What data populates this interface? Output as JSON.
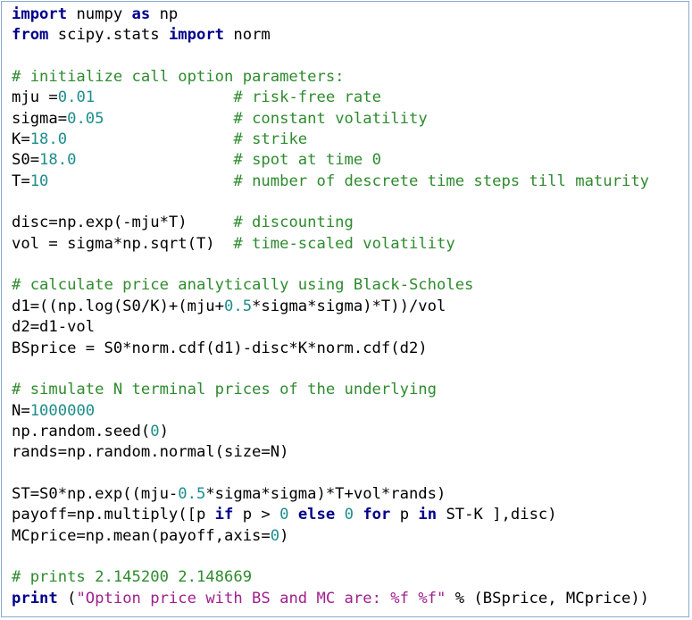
{
  "colors": {
    "keyword": "#00008b",
    "number": "#1e8c8c",
    "comment": "#2e8b2e",
    "string": "#a0208c",
    "text": "#000000",
    "border": "#8aa8d4"
  },
  "code_lines": [
    [
      {
        "t": "import",
        "c": "kw"
      },
      {
        "t": " numpy ",
        "c": ""
      },
      {
        "t": "as",
        "c": "kw"
      },
      {
        "t": " np",
        "c": ""
      }
    ],
    [
      {
        "t": "from",
        "c": "kw"
      },
      {
        "t": " scipy.stats ",
        "c": ""
      },
      {
        "t": "import",
        "c": "kw"
      },
      {
        "t": " norm",
        "c": ""
      }
    ],
    [],
    [
      {
        "t": "# initialize call option parameters:",
        "c": "com"
      }
    ],
    [
      {
        "t": "mju =",
        "c": ""
      },
      {
        "t": "0.01",
        "c": "num"
      },
      {
        "t": "               ",
        "c": ""
      },
      {
        "t": "# risk-free rate",
        "c": "com"
      }
    ],
    [
      {
        "t": "sigma=",
        "c": ""
      },
      {
        "t": "0.05",
        "c": "num"
      },
      {
        "t": "              ",
        "c": ""
      },
      {
        "t": "# constant volatility",
        "c": "com"
      }
    ],
    [
      {
        "t": "K=",
        "c": ""
      },
      {
        "t": "18.0",
        "c": "num"
      },
      {
        "t": "                  ",
        "c": ""
      },
      {
        "t": "# strike",
        "c": "com"
      }
    ],
    [
      {
        "t": "S0=",
        "c": ""
      },
      {
        "t": "18.0",
        "c": "num"
      },
      {
        "t": "                 ",
        "c": ""
      },
      {
        "t": "# spot at time 0",
        "c": "com"
      }
    ],
    [
      {
        "t": "T=",
        "c": ""
      },
      {
        "t": "10",
        "c": "num"
      },
      {
        "t": "                    ",
        "c": ""
      },
      {
        "t": "# number of descrete time steps till maturity",
        "c": "com"
      }
    ],
    [],
    [
      {
        "t": "disc=np.exp(-mju*T)     ",
        "c": ""
      },
      {
        "t": "# discounting",
        "c": "com"
      }
    ],
    [
      {
        "t": "vol = sigma*np.sqrt(T)  ",
        "c": ""
      },
      {
        "t": "# time-scaled volatility",
        "c": "com"
      }
    ],
    [],
    [
      {
        "t": "# calculate price analytically using Black-Scholes",
        "c": "com"
      }
    ],
    [
      {
        "t": "d1=((np.log(S0/K)+(mju+",
        "c": ""
      },
      {
        "t": "0.5",
        "c": "num"
      },
      {
        "t": "*sigma*sigma)*T))/vol",
        "c": ""
      }
    ],
    [
      {
        "t": "d2=d1-vol",
        "c": ""
      }
    ],
    [
      {
        "t": "BSprice = S0*norm.cdf(d1)-disc*K*norm.cdf(d2)",
        "c": ""
      }
    ],
    [],
    [
      {
        "t": "# simulate N terminal prices of the underlying",
        "c": "com"
      }
    ],
    [
      {
        "t": "N=",
        "c": ""
      },
      {
        "t": "1000000",
        "c": "num"
      }
    ],
    [
      {
        "t": "np.random.seed(",
        "c": ""
      },
      {
        "t": "0",
        "c": "num"
      },
      {
        "t": ")",
        "c": ""
      }
    ],
    [
      {
        "t": "rands=np.random.normal(size=N)",
        "c": ""
      }
    ],
    [],
    [
      {
        "t": "ST=S0*np.exp((mju-",
        "c": ""
      },
      {
        "t": "0.5",
        "c": "num"
      },
      {
        "t": "*sigma*sigma)*T+vol*rands)",
        "c": ""
      }
    ],
    [
      {
        "t": "payoff=np.multiply([p ",
        "c": ""
      },
      {
        "t": "if",
        "c": "kw"
      },
      {
        "t": " p > ",
        "c": ""
      },
      {
        "t": "0",
        "c": "num"
      },
      {
        "t": " ",
        "c": ""
      },
      {
        "t": "else",
        "c": "kw"
      },
      {
        "t": " ",
        "c": ""
      },
      {
        "t": "0",
        "c": "num"
      },
      {
        "t": " ",
        "c": ""
      },
      {
        "t": "for",
        "c": "kw"
      },
      {
        "t": " p ",
        "c": ""
      },
      {
        "t": "in",
        "c": "kw"
      },
      {
        "t": " ST-K ],disc)",
        "c": ""
      }
    ],
    [
      {
        "t": "MCprice=np.mean(payoff,axis=",
        "c": ""
      },
      {
        "t": "0",
        "c": "num"
      },
      {
        "t": ")",
        "c": ""
      }
    ],
    [],
    [
      {
        "t": "# prints 2.145200 2.148669",
        "c": "com"
      }
    ],
    [
      {
        "t": "print",
        "c": "kw"
      },
      {
        "t": " (",
        "c": ""
      },
      {
        "t": "\"Option price with BS and MC are: %f %f\"",
        "c": "str"
      },
      {
        "t": " % (BSprice, MCprice))",
        "c": ""
      }
    ]
  ]
}
